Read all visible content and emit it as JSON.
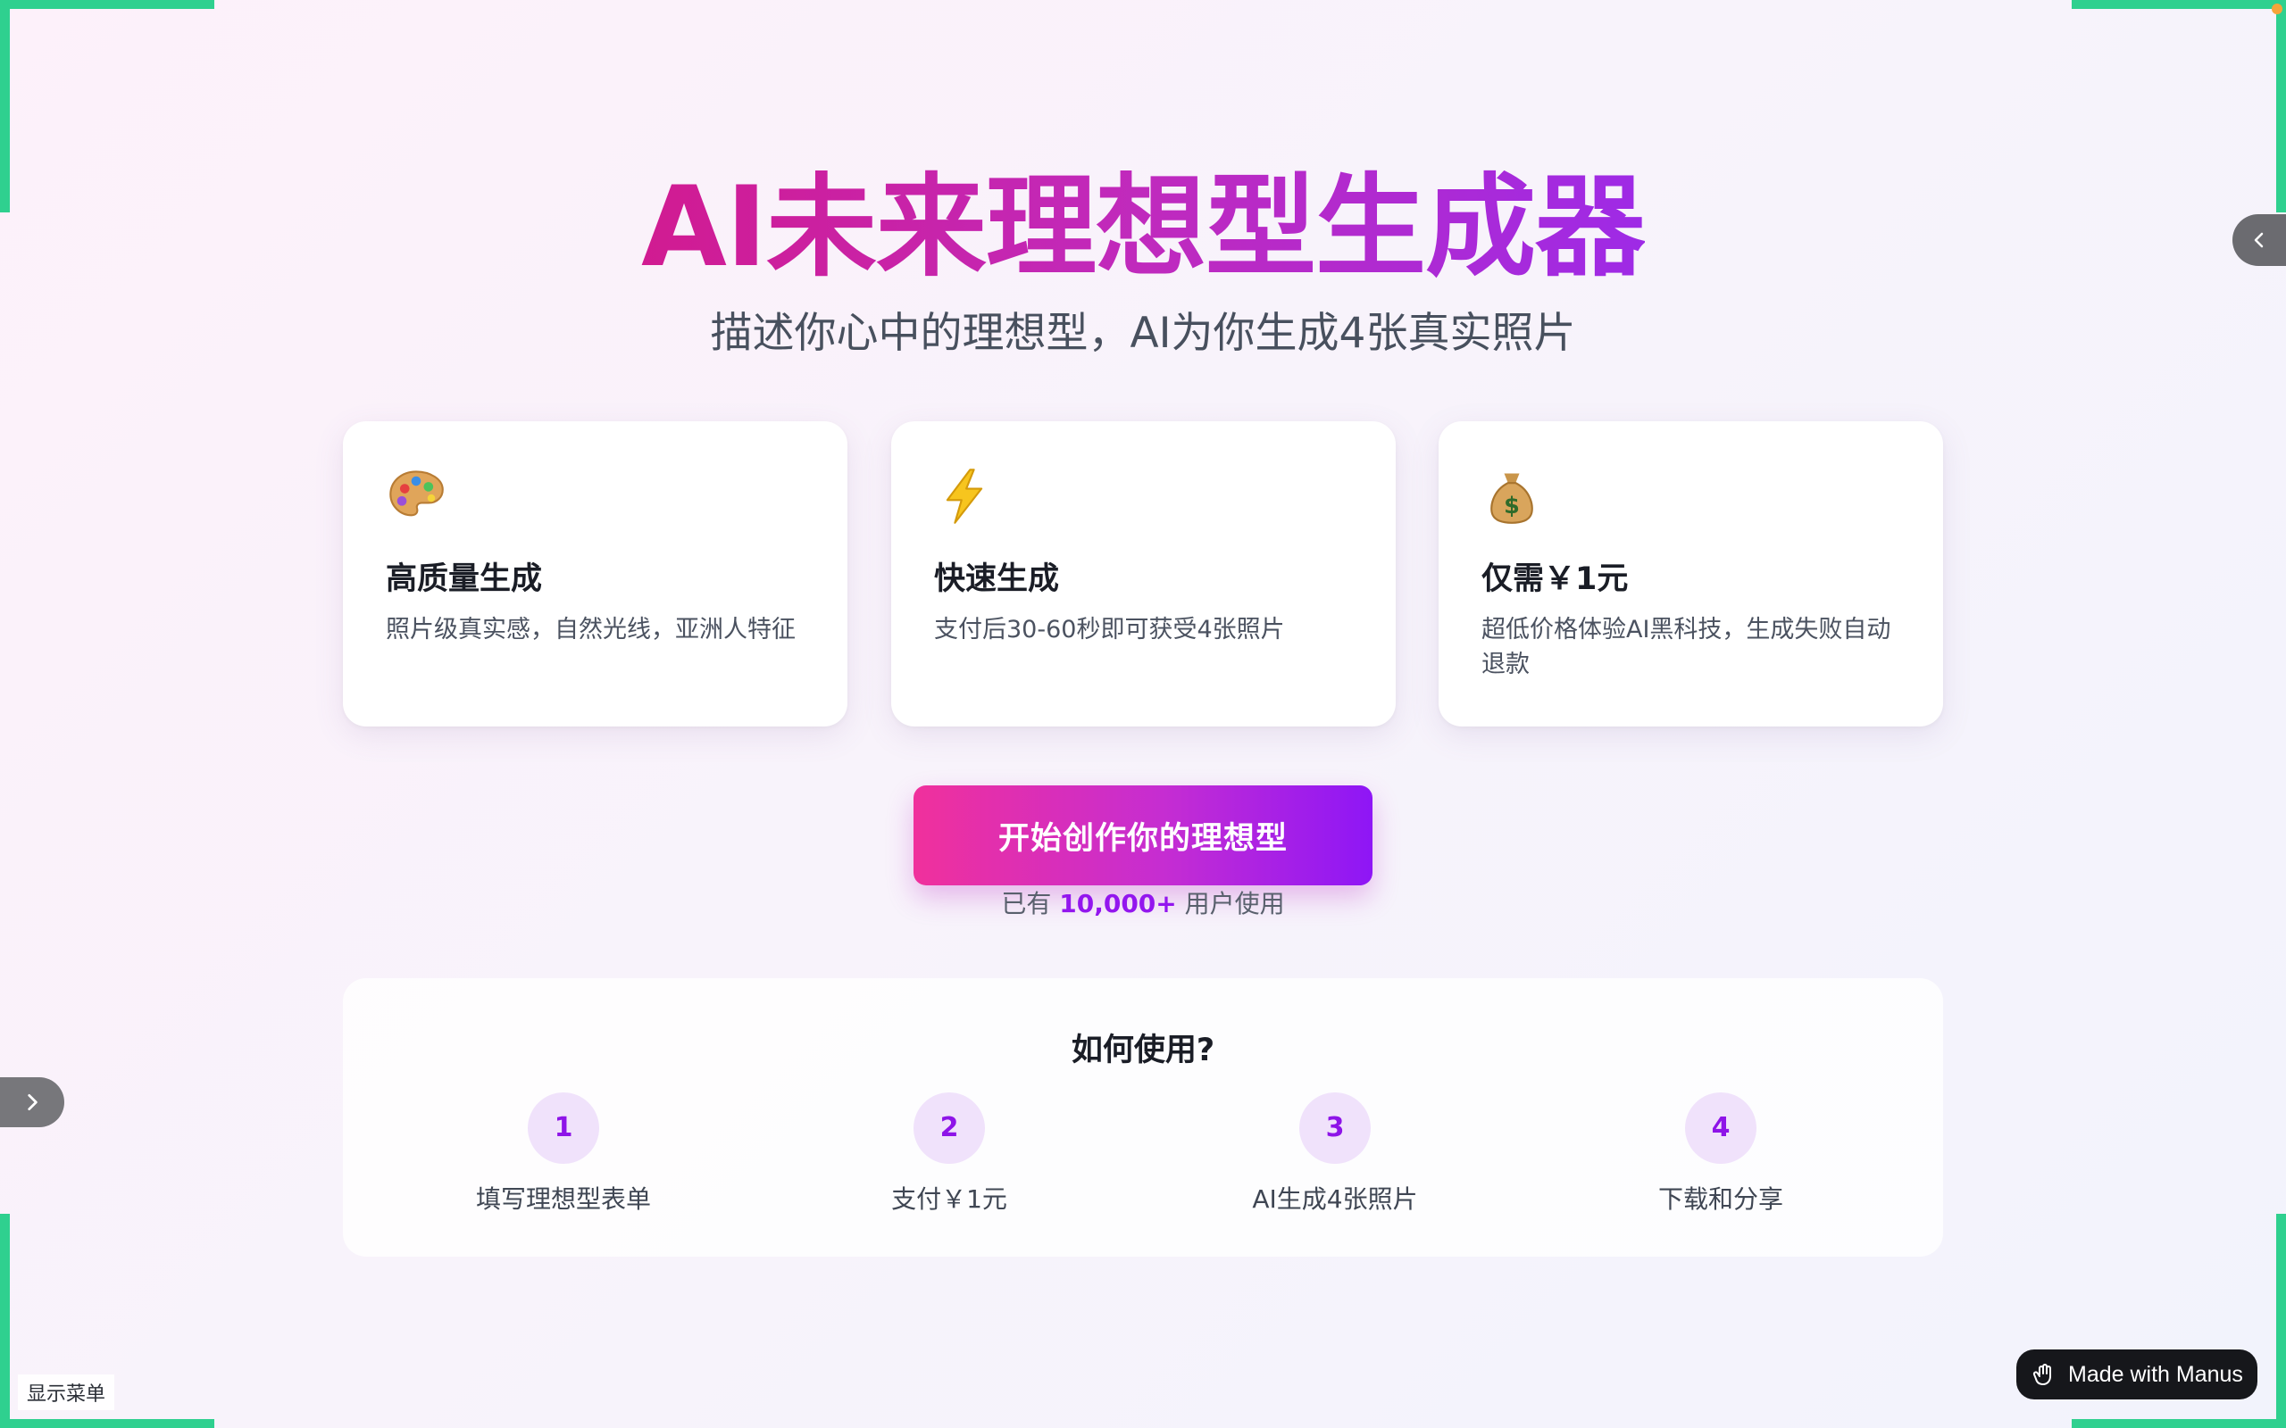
{
  "hero": {
    "title": "AI未来理想型生成器",
    "subtitle": "描述你心中的理想型，AI为你生成4张真实照片"
  },
  "features": [
    {
      "icon": "palette-icon",
      "title": "高质量生成",
      "desc": "照片级真实感，自然光线，亚洲人特征"
    },
    {
      "icon": "lightning-icon",
      "title": "快速生成",
      "desc": "支付后30-60秒即可获受4张照片"
    },
    {
      "icon": "money-bag-icon",
      "title": "仅需￥1元",
      "desc": "超低价格体验AI黑科技，生成失败自动退款"
    }
  ],
  "cta": {
    "label": "开始创作你的理想型",
    "users_prefix": "已有",
    "users_count": "10,000+",
    "users_suffix": "用户使用"
  },
  "howto": {
    "title": "如何使用?",
    "steps": [
      {
        "num": "1",
        "label": "填写理想型表单"
      },
      {
        "num": "2",
        "label": "支付￥1元"
      },
      {
        "num": "3",
        "label": "AI生成4张照片"
      },
      {
        "num": "4",
        "label": "下载和分享"
      }
    ]
  },
  "footer": {
    "show_menu": "显示菜单",
    "badge": "Made with Manus"
  },
  "colors": {
    "accent_pink": "#f0309c",
    "accent_purple": "#8e16f6",
    "frame_green": "#2fd08f"
  }
}
